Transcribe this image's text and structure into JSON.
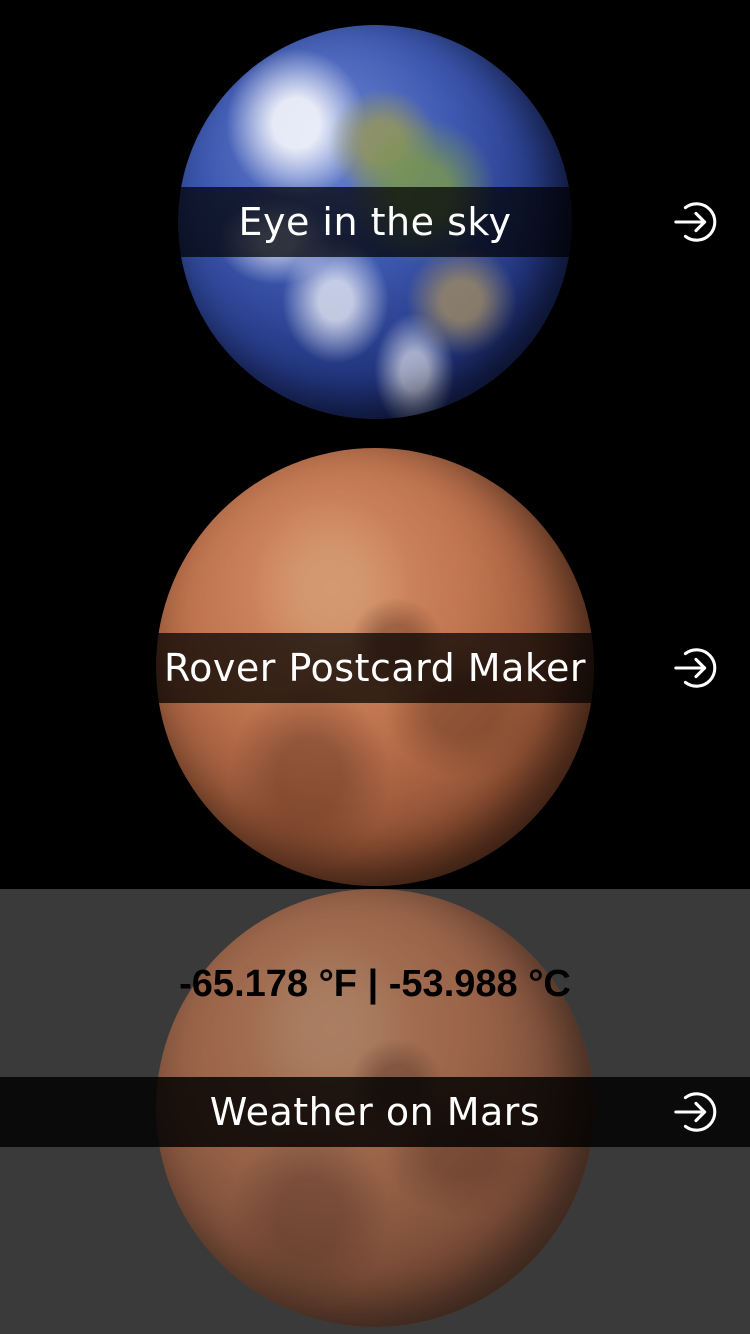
{
  "sections": [
    {
      "label": "Eye in the sky"
    },
    {
      "label": "Rover Postcard Maker"
    },
    {
      "label": "Weather on Mars"
    }
  ],
  "weather": {
    "temperature_f": "-65.178 °F",
    "separator": "|",
    "temperature_c": "-53.988 °C"
  },
  "icons": {
    "open": "arrow-into-circle-icon"
  },
  "colors": {
    "background": "#000000",
    "weather_background": "#3a3a3a",
    "band": "rgba(0,0,0,0.72)",
    "text": "#ffffff"
  }
}
